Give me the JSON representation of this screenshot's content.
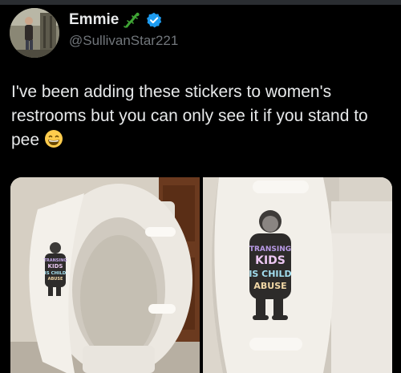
{
  "author": {
    "name": "Emmie",
    "name_emoji": "lizard-emoji",
    "verified": true,
    "handle": "@SullivanStar221"
  },
  "tweet": {
    "text": "I've been adding these stickers to women's restrooms but you can only see it if you stand to pee",
    "trailing_emoji": "grinning-face-emoji"
  },
  "media": {
    "photo_count": 2,
    "sticker_lines": [
      "TRANSING",
      "KIDS",
      "IS CHILD",
      "ABUSE"
    ]
  },
  "colors": {
    "background": "#000000",
    "text_primary": "#e7e9ea",
    "text_secondary": "#71767b",
    "verified_blue": "#1d9bf0"
  }
}
